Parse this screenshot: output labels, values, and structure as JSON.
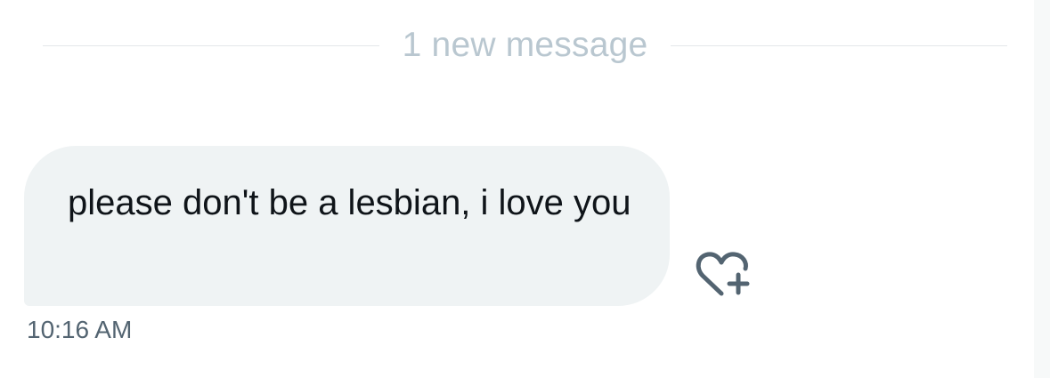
{
  "divider": {
    "label": "1 new message"
  },
  "message": {
    "text": "please don't be a lesbian, i love you",
    "time": "10:16 AM"
  },
  "actions": {
    "react_icon": "heart-plus-icon"
  },
  "colors": {
    "bubble_background": "#eff3f4",
    "message_text": "#0f1419",
    "divider_label": "#b9c7d0",
    "timestamp": "#536471",
    "icon": "#536471"
  }
}
